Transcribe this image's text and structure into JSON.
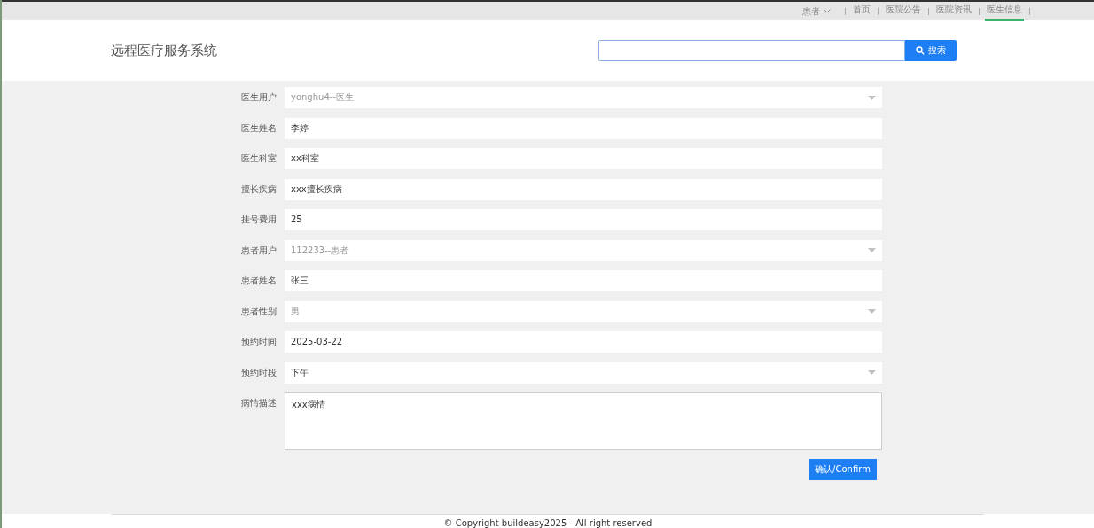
{
  "top_nav": {
    "user_menu": "患者",
    "items": [
      {
        "label": "首页",
        "selected": false
      },
      {
        "label": "医院公告",
        "selected": false
      },
      {
        "label": "医院资讯",
        "selected": false
      },
      {
        "label": "医生信息",
        "selected": true
      }
    ]
  },
  "header": {
    "title": "远程医疗服务系统",
    "search_button": "搜索"
  },
  "form": {
    "fields": [
      {
        "label": "医生用户",
        "kind": "select",
        "value": "yonghu4--医生",
        "disabled": true
      },
      {
        "label": "医生姓名",
        "kind": "input",
        "value": "李婷",
        "disabled": false
      },
      {
        "label": "医生科室",
        "kind": "input",
        "value": "xx科室",
        "disabled": false
      },
      {
        "label": "擅长疾病",
        "kind": "input",
        "value": "xxx擅长疾病",
        "disabled": false
      },
      {
        "label": "挂号费用",
        "kind": "input",
        "value": "25",
        "disabled": false
      },
      {
        "label": "患者用户",
        "kind": "select",
        "value": "112233--患者",
        "disabled": true
      },
      {
        "label": "患者姓名",
        "kind": "input",
        "value": "张三",
        "disabled": false
      },
      {
        "label": "患者性别",
        "kind": "select",
        "value": "男",
        "disabled": true
      },
      {
        "label": "预约时间",
        "kind": "input",
        "value": "2025-03-22",
        "disabled": false
      },
      {
        "label": "预约时段",
        "kind": "select",
        "value": "下午",
        "disabled": false
      },
      {
        "label": "病情描述",
        "kind": "textarea",
        "value": "xxx病情",
        "disabled": false
      }
    ],
    "confirm_button": "确认/Confirm"
  },
  "footer": "© Copyright buildeasy2025 - All right reserved"
}
